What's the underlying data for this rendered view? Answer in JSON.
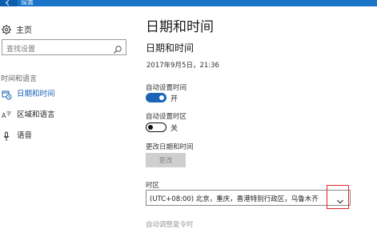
{
  "window": {
    "title": "设置"
  },
  "sidebar": {
    "home_label": "主页",
    "search_placeholder": "查找设置",
    "section_title": "时间和语言",
    "items": [
      {
        "label": "日期和时间",
        "icon": "calendar-clock-icon",
        "active": true
      },
      {
        "label": "区域和语言",
        "icon": "region-language-icon",
        "active": false
      },
      {
        "label": "语音",
        "icon": "microphone-icon",
        "active": false
      }
    ]
  },
  "main": {
    "page_title": "日期和时间",
    "sub_title": "日期和时间",
    "current_datetime": "2017年9月5日，21:36",
    "auto_time": {
      "label": "自动设置时间",
      "state": "开",
      "on": true
    },
    "auto_timezone": {
      "label": "自动设置时区",
      "state": "关",
      "on": false
    },
    "change_datetime": {
      "label": "更改日期和时间",
      "button": "更改"
    },
    "timezone": {
      "label": "时区",
      "value": "(UTC+08:00) 北京，重庆，香港特别行政区，乌鲁木齐"
    },
    "dst_label": "自动调整夏令时"
  },
  "colors": {
    "accent": "#1a64b7",
    "titlebar": "#1a75c8",
    "highlight": "#e0242d"
  }
}
